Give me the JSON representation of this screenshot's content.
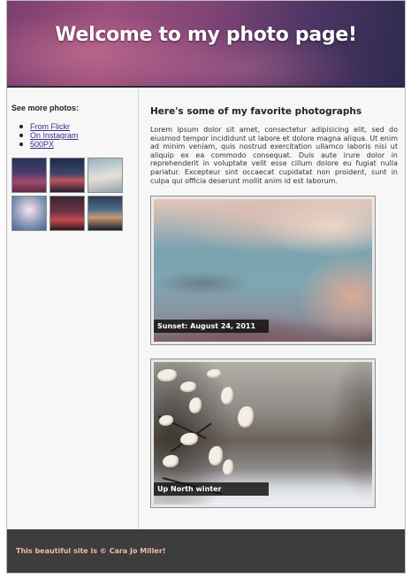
{
  "header": {
    "title": "Welcome to my photo page!"
  },
  "sidebar": {
    "heading": "See more photos:",
    "links": [
      {
        "label": "From Flickr"
      },
      {
        "label": "On Instagram"
      },
      {
        "label": "500PX"
      }
    ]
  },
  "main": {
    "heading": "Here's some of my favorite photographs",
    "intro": "Lorem ipsum dolor sit amet, consectetur adipisicing elit, sed do eiusmod tempor incididunt ut labore et dolore magna aliqua. Ut enim ad minim veniam, quis nostrud exercitation ullamco laboris nisi ut aliquip ex ea commodo consequat. Duis aute irure dolor in reprehenderit in voluptate velit esse cillum dolore eu fugiat nulla pariatur. Excepteur sint occaecat cupidatat non proident, sunt in culpa qui officia deserunt mollit anim id est laborum.",
    "photos": [
      {
        "caption": "Sunset: August 24, 2011"
      },
      {
        "caption": "Up North winter"
      }
    ]
  },
  "footer": {
    "text": "This beautiful site is © Cara Jo Miller!"
  },
  "colors": {
    "footer_text": "#f4b7b1",
    "link": "#3b2a86",
    "footer_bg": "#3d3d3d"
  }
}
